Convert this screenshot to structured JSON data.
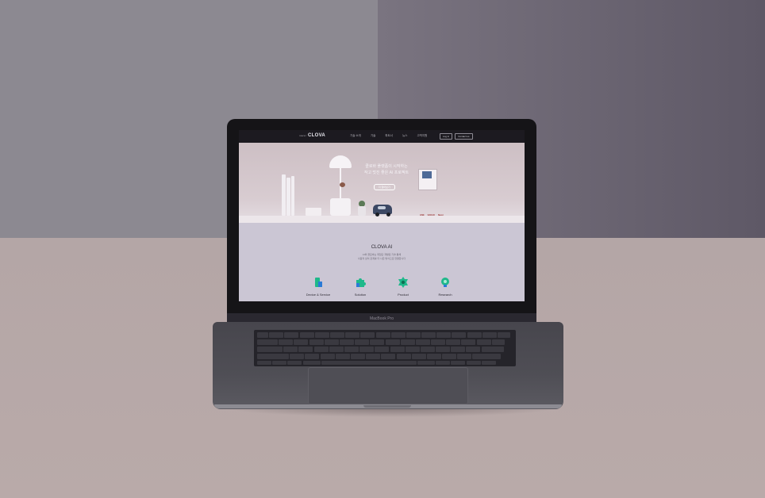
{
  "device": {
    "model_label": "MacBook Pro"
  },
  "site": {
    "nav": {
      "logo_prefix": "naver",
      "logo": "CLOVA",
      "menu": [
        "기술 소개",
        "기술",
        "파트너",
        "뉴스",
        "고객지원"
      ],
      "buttons": [
        "Log in",
        "Contact us"
      ]
    },
    "hero": {
      "headline_line1": "클로바 플랫폼이 시작하는",
      "headline_line2": "작고 멋진 좋은 AI 프로젝트",
      "cta": "더 알아보기",
      "partners": [
        "LINE",
        "KAKAO",
        "Naver"
      ]
    },
    "about": {
      "title": "CLOVA AI",
      "desc_line1": "AI와 클로바는 최첨단 개발된 기술 통해",
      "desc_line2": "사람과 삶이 관계를 더 나은 방식으로 연결합니다"
    },
    "services": [
      {
        "label": "Device & Service",
        "icon": "device-icon"
      },
      {
        "label": "Solution",
        "icon": "puzzle-icon"
      },
      {
        "label": "Product",
        "icon": "gear-icon"
      },
      {
        "label": "Research",
        "icon": "bulb-icon"
      }
    ]
  },
  "colors": {
    "accent": "#1fb88a",
    "screen_bg": "#cbc6d4",
    "nav_bg": "#1c1a20"
  }
}
